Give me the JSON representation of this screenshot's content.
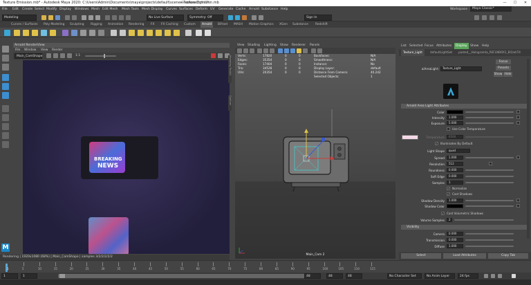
{
  "window": {
    "title": "Texture Emission.mb* - Autodesk Maya 2020: C:\\Users\\Admin\\Documents\\maya\\projects\\default\\scenes\\Texture Emission.mb",
    "right": "---  aiAreaLight1*"
  },
  "menubar": {
    "items": [
      "File",
      "Edit",
      "Create",
      "Select",
      "Modify",
      "Display",
      "Windows",
      "Mesh",
      "Edit Mesh",
      "Mesh Tools",
      "Mesh Display",
      "Curves",
      "Surfaces",
      "Deform",
      "UV",
      "Generate",
      "Cache",
      "Arnold",
      "Substance",
      "Help"
    ],
    "workspace_label": "Workspace :",
    "workspace_value": "Maya Classic*"
  },
  "statusline": {
    "mode": "Modeling",
    "surface": "No Live Surface",
    "symmetry": "Symmetry: Off",
    "signin": "Sign In"
  },
  "shelf": {
    "tabs": [
      "Curves / Surfaces",
      "Poly Modeling",
      "Sculpting",
      "Rigging",
      "Animation",
      "Rendering",
      "FX",
      "FX Caching",
      "Custom",
      "Arnold",
      "Bifrost",
      "MASH",
      "Motion Graphics",
      "XGen",
      "Substance",
      "Redshift"
    ],
    "active_tab": "Arnold"
  },
  "renderview": {
    "title": "Arnold RenderView",
    "menu": [
      "File",
      "Window",
      "View",
      "Render"
    ],
    "camera": "Main_CamShape",
    "ratio": "1:1",
    "tv_text_line1": "BREAKING",
    "tv_text_line2": "NEWS",
    "status": "Rendering | 1920x1080 (68%) | Main_CamShape | samples 3/2/2/2/2/2"
  },
  "side_tabs": {
    "left": "Modeling Toolkit",
    "middle": "Attribute Editor",
    "right": "Outliner"
  },
  "viewport": {
    "menu": [
      "View",
      "Shading",
      "Lighting",
      "Show",
      "Renderer",
      "Panels"
    ],
    "hud": [
      {
        "label": "Verts:",
        "v1": "17820",
        "v2": "0",
        "v3": "0"
      },
      {
        "label": "Edges:",
        "v1": "35354",
        "v2": "0",
        "v3": "0"
      },
      {
        "label": "Faces:",
        "v1": "17404",
        "v2": "0",
        "v3": "0"
      },
      {
        "label": "Tris:",
        "v1": "34528",
        "v2": "0",
        "v3": "0"
      },
      {
        "label": "UVs:",
        "v1": "20354",
        "v2": "0",
        "v3": "0"
      }
    ],
    "hud_right": [
      {
        "label": "Backfaces:",
        "value": "N/A"
      },
      {
        "label": "Smoothness:",
        "value": "N/A"
      },
      {
        "label": "Instance:",
        "value": "No"
      },
      {
        "label": "Display Layer:",
        "value": "default"
      },
      {
        "label": "Distance From Camera:",
        "value": "40.242"
      },
      {
        "label": "Selected Objects:",
        "value": "1"
      }
    ],
    "camera_label": "Main_Cam 2"
  },
  "attribute_editor": {
    "menu": [
      "List",
      "Selected",
      "Focus",
      "Attributes",
      "Display",
      "Show",
      "Help"
    ],
    "highlight_menu": "Display",
    "node_tabs": [
      "Texture_Light",
      "defaultLightSet",
      "pasted__Hologramla_REFLNBOX1_Bl1lahT4"
    ],
    "node_label": "aiAreaLight:",
    "node_value": "Texture_Light",
    "side_buttons": [
      "Focus",
      "Presets",
      "Show",
      "Hide"
    ],
    "section_title": "Arnold Area Light Attributes",
    "rows": {
      "color_label": "Color",
      "intensity_label": "Intensity",
      "intensity_value": "1.000",
      "exposure_label": "Exposure",
      "exposure_value": "5.000",
      "use_color_temp": "Use Color Temperature",
      "temperature_label": "Temperature",
      "temperature_value": "6500",
      "illuminates_default": "Illuminates By Default",
      "light_shape_label": "Light Shape",
      "light_shape_value": "quad",
      "spread_label": "Spread",
      "spread_value": "1.000",
      "resolution_label": "Resolution",
      "resolution_value": "512",
      "roundness_label": "Roundness",
      "roundness_value": "0.000",
      "soft_edge_label": "Soft Edge",
      "soft_edge_value": "0.000",
      "samples_label": "Samples",
      "samples_value": "1",
      "normalize": "Normalize",
      "cast_shadows": "Cast Shadows",
      "shadow_density_label": "Shadow Density",
      "shadow_density_value": "1.000",
      "shadow_color_label": "Shadow Color",
      "cast_volumetric": "Cast Volumetric Shadows",
      "volume_samples_label": "Volume Samples",
      "volume_samples_value": "2"
    },
    "visibility_title": "Visibility",
    "visibility_rows": {
      "camera_label": "Camera",
      "camera_value": "0.000",
      "transmission_label": "Transmission",
      "transmission_value": "0.000",
      "diffuse_label": "Diffuse",
      "diffuse_value": "1.000"
    },
    "buttons": [
      "Select",
      "Load Attributes",
      "Copy Tab"
    ]
  },
  "timeslider": {
    "ticks": [
      "5",
      "10",
      "15",
      "20",
      "25",
      "30",
      "35",
      "40",
      "45",
      "50",
      "55",
      "60",
      "65",
      "70",
      "75",
      "80",
      "85",
      "90",
      "95",
      "100",
      "105",
      "110",
      "115"
    ],
    "current_frame": "1"
  },
  "rangebar": {
    "start": "1",
    "inner_start": "1",
    "inner_end": "48",
    "end1": "48",
    "end2": "48",
    "char_set": "No Character Set",
    "anim_layer": "No Anim Layer",
    "fps": "24 fps"
  },
  "colors": {
    "bg": "#444444",
    "panel_dark": "#2b2b2b",
    "render_bg": "#221f3c",
    "active_tab": "#5ba55b",
    "arnold_logo": "#3aa7d6"
  }
}
